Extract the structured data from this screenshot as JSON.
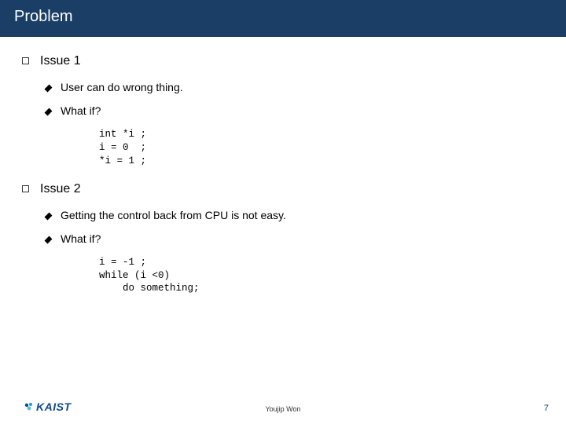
{
  "title": "Problem",
  "issues": [
    {
      "label": "Issue 1",
      "points": [
        {
          "text": "User can do wrong thing."
        },
        {
          "text": "What if?",
          "code": "int *i ;\ni = 0  ;\n*i = 1 ;"
        }
      ]
    },
    {
      "label": "Issue 2",
      "points": [
        {
          "text": "Getting the control back from CPU is not easy."
        },
        {
          "text": "What if?",
          "code": "i = -1 ;\nwhile (i <0)\n    do something;"
        }
      ]
    }
  ],
  "footer": {
    "logo_text": "KAIST",
    "author": "Youjip Won",
    "page_number": "7"
  }
}
